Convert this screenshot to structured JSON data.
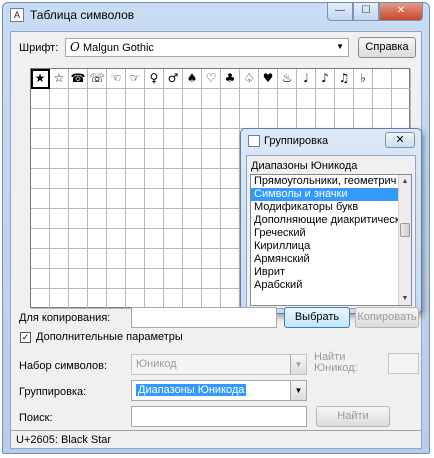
{
  "window": {
    "title": "Таблица символов",
    "min": "—",
    "max": "☐",
    "close": "✕"
  },
  "font_label": "Шрифт:",
  "font": {
    "value": "Malgun Gothic",
    "icon": "O"
  },
  "help_button": "Справка",
  "symbols": [
    "★",
    "☆",
    "☎",
    "☏",
    "☜",
    "☞",
    "♀",
    "♂",
    "♠",
    "♡",
    "♣",
    "♤",
    "♥",
    "♨",
    "♩",
    "♪",
    "♫",
    "♭",
    "",
    ""
  ],
  "popup": {
    "title": "Группировка",
    "close": "✕",
    "header": "Диапазоны Юникода",
    "items": [
      "Прямоугольники, геометрич",
      "Символы и значки",
      "Модификаторы букв",
      "Дополняющие диакритическ",
      "Греческий",
      "Кириллица",
      "Армянский",
      "Иврит",
      "Арабский"
    ],
    "active_index": 1
  },
  "copy": {
    "label": "Для копирования:",
    "value": "",
    "select_button": "Выбрать",
    "copy_button": "Копировать"
  },
  "advanced": {
    "label": "Дополнительные параметры",
    "checked": "✓"
  },
  "charset": {
    "label": "Набор символов:",
    "value": "Юникод"
  },
  "find_unicode": {
    "label_line1": "Найти",
    "label_line2": "Юникод:"
  },
  "grouping": {
    "label": "Группировка:",
    "value": "Диапазоны Юникода"
  },
  "search": {
    "label": "Поиск:",
    "value": "",
    "button": "Найти"
  },
  "status": "U+2605: Black Star"
}
